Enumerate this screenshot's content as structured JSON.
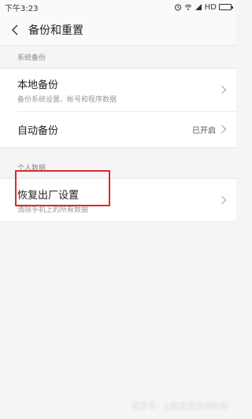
{
  "status_bar": {
    "time": "下午3:23",
    "network": "HD"
  },
  "header": {
    "title": "备份和重置"
  },
  "sections": {
    "system": {
      "label": "系统备份",
      "local_backup": {
        "title": "本地备份",
        "subtitle": "备份系统设置、帐号和程序数据"
      },
      "auto_backup": {
        "title": "自动备份",
        "value": "已开启"
      }
    },
    "personal": {
      "label": "个人数据",
      "factory_reset": {
        "title": "恢复出厂设置",
        "subtitle": "清除手机上的所有数据"
      }
    }
  },
  "watermark": "百家号: 上饶玉翡空间科技",
  "colors": {
    "highlight": "#e0262d",
    "background": "#f5f5f5"
  }
}
